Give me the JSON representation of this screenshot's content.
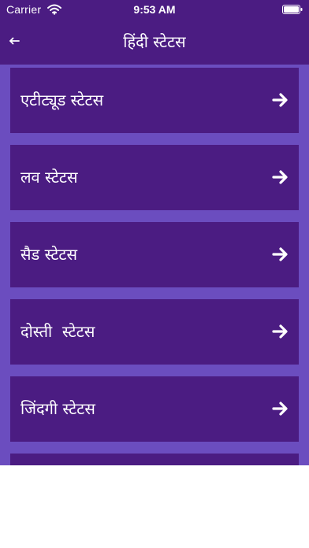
{
  "status_bar": {
    "carrier": "Carrier",
    "time": "9:53 AM",
    "icons": [
      "wifi-icon",
      "battery-icon"
    ]
  },
  "header": {
    "title": "हिंदी स्टेटस",
    "back_icon": "back-arrow-icon"
  },
  "list": {
    "items": [
      {
        "label": "एटीट्यूड स्टेटस",
        "icon": "right-arrow-icon"
      },
      {
        "label": "लव स्टेटस",
        "icon": "right-arrow-icon"
      },
      {
        "label": "सैड स्टेटस",
        "icon": "right-arrow-icon"
      },
      {
        "label": "दोस्ती  स्टेटस",
        "icon": "right-arrow-icon"
      },
      {
        "label": "जिंदगी स्टेटस",
        "icon": "right-arrow-icon"
      },
      {
        "label": "",
        "icon": ""
      }
    ]
  },
  "colors": {
    "header_bg": "#4b1c82",
    "item_bg": "#4b1c82",
    "list_bg": "#6b4dbf",
    "text": "#ffffff"
  }
}
